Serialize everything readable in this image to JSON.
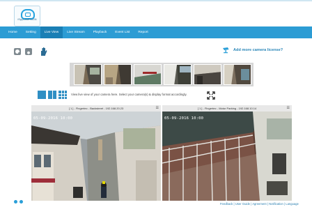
{
  "brand": {
    "logo_text": "iSpyCAMPAIGN"
  },
  "nav": {
    "items": [
      {
        "label": "Home"
      },
      {
        "label": "Setting"
      },
      {
        "label": "Live View"
      },
      {
        "label": "Live Stream"
      },
      {
        "label": "Playback"
      },
      {
        "label": "Event List"
      },
      {
        "label": "Report"
      }
    ],
    "active_index": 2
  },
  "toolbar": {
    "add_license_label": "Add more camera license?"
  },
  "thumbnails": {
    "count": 6
  },
  "layout": {
    "instructions": "View live view of your camera here. Select your camera(s) & display format accordingly."
  },
  "cameras": [
    {
      "title": "[ 1 ] - Fingertec - Backstreet - 192.168.20.23",
      "timestamp": "05-09-2016  10:00"
    },
    {
      "title": "[ 1 ] - Fingertec - Motor Parking - 192.168.10.14",
      "timestamp": "05-09-2016  10:00"
    }
  ],
  "footer": {
    "links": [
      "Feedback",
      "User Guide",
      "Agreement",
      "Notification",
      "Language"
    ]
  },
  "colors": {
    "nav_bg": "#2c9cd4",
    "nav_active": "#1a7fb5",
    "accent": "#2a86b8"
  }
}
